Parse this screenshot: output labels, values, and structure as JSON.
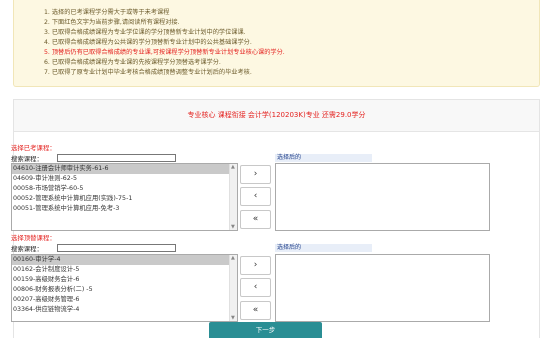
{
  "notice": {
    "items": [
      {
        "text": "1. 选择的已考课程学分需大于或等于未考课程",
        "red": false
      },
      {
        "text": "2. 下面红色文字为当前步骤,请阅读所有课程对接.",
        "red": false
      },
      {
        "text": "3. 已取得合格成绩课程为专业学位课的学分顶替新专业计划中的学位课课.",
        "red": false
      },
      {
        "text": "4. 已取得合格成绩课程为公共课的学分顶替新专业计划中的公共基础课学分.",
        "red": false
      },
      {
        "text": "5. 顶替后仍有已取得合格成绩的专业课,可按课程学分顶替新专业计划专业核心课的学分.",
        "red": true
      },
      {
        "text": "6. 已取得合格成绩课程为专业课的先按课程学分顶替选考课学分.",
        "red": false
      },
      {
        "text": "7. 已取得了原专业计划中毕业考核合格成绩顶替调整专业计划后的毕业考核.",
        "red": false
      }
    ]
  },
  "panel": {
    "header": "专业核心 课程衔接 会计学(120203K)专业 还需29.0学分"
  },
  "exam_section": {
    "label": "选择已考课程：",
    "search_label": "搜索课程：",
    "search_value": "",
    "options": [
      "04610-注册会计师审计实务-61-6",
      "04609-审计准则-62-5",
      "00058-市场营销学-60-5",
      "00052-管理系统中计算机应用(实践)-75-1",
      "00051-管理系统中计算机应用-免考-3"
    ],
    "selected_index": 0,
    "after_label": "选择后的"
  },
  "replace_section": {
    "label": "选择顶替课程：",
    "search_label": "搜索课程：",
    "search_value": "",
    "options": [
      "00160-审计学-4",
      "00162-会计制度设计-5",
      "00159-高级财务会计-6",
      "00806-财务报表分析(二) -5",
      "00207-高级财务管理-6",
      "03364-供应链物流学-4"
    ],
    "selected_index": 0,
    "after_label": "选择后的"
  },
  "buttons": {
    "move_right": "›",
    "move_left": "‹",
    "move_all_left": "«",
    "next": "下一步"
  },
  "scroll": {
    "up": "▲",
    "down": "▼"
  }
}
